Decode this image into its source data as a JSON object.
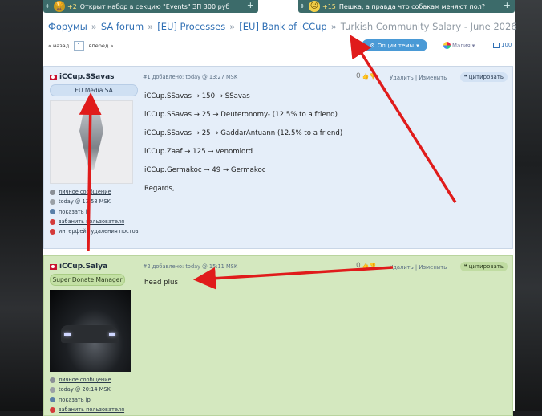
{
  "banners": [
    {
      "points": "+2",
      "text": "Открыт набор в секцию \"Events\" ЗП 300 руб"
    },
    {
      "points": "+15",
      "text": "Пешка, а правда что собакам меняют пол?"
    }
  ],
  "breadcrumb": {
    "items": [
      "Форумы",
      "SA forum",
      "[EU] Processes",
      "[EU] Bank of iCCup"
    ],
    "current": "Turkish Community Salary - June 2026"
  },
  "pager": {
    "back": "« назад",
    "page": "1",
    "forward": "вперед »"
  },
  "toolbar": {
    "options_label": "Опции темы",
    "magic_label": "Магия",
    "count_label": "100"
  },
  "posts": [
    {
      "author": "iCCup.SSavas",
      "badge": "EU Media SA",
      "meta": "#1 добавлено: today @ 13:27 MSK",
      "likes": "0",
      "delete_label": "Удалить",
      "edit_label": "Изменить",
      "quote_label": "цитировать",
      "links": [
        "личное сообщение",
        "today @ 13:58 MSK",
        "показать ip",
        "забанить пользователя",
        "интерфейс удаления постов"
      ],
      "lines": [
        "iCCup.SSavas → 150 → SSavas",
        "iCCup.SSavas → 25 → Deuteronomy- (12.5% to a friend)",
        "iCCup.SSavas → 25 → GaddarAntuann (12.5% to a friend)",
        "iCCup.Zaaf → 125 → venomlord",
        "iCCup.Germakoc → 49 → Germakoc",
        "Regards,"
      ]
    },
    {
      "author": "iCCup.Salya",
      "badge": "Super Donate Manager",
      "meta": "#2 добавлено: today @ 15:11 MSK",
      "likes": "0",
      "delete_label": "Удалить",
      "edit_label": "Изменить",
      "quote_label": "цитировать",
      "links": [
        "личное сообщение",
        "today @ 20:14 MSK",
        "показать ip",
        "забанить пользователя"
      ],
      "lines": [
        "head plus"
      ]
    }
  ],
  "colors": {
    "accent": "#2f6fb4",
    "post1_bg": "#e5eef9",
    "post2_bg": "#d4e8bf",
    "annotation": "#e01b1b"
  }
}
